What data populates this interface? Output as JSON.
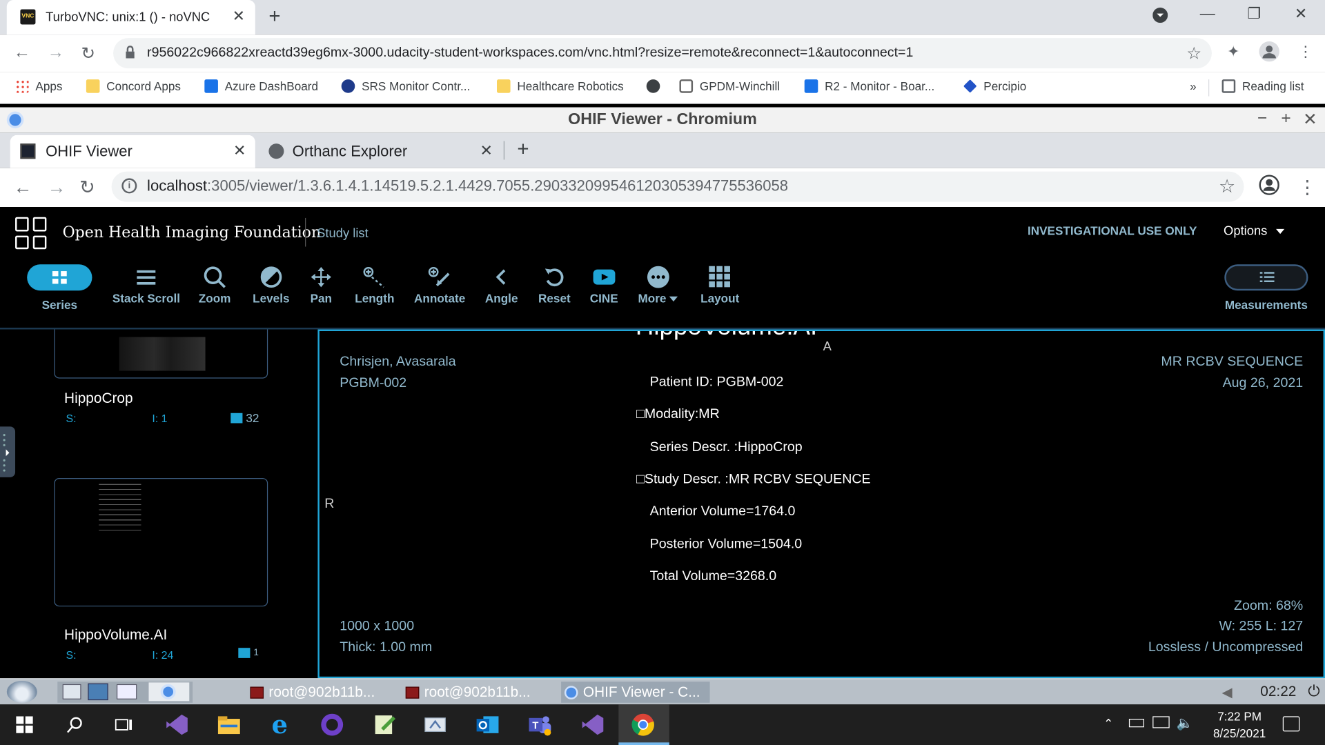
{
  "outer_browser": {
    "tab_title": "TurboVNC: unix:1 () - noVNC",
    "url": "r956022c966822xreactd39eg6mx-3000.udacity-student-workspaces.com/vnc.html?resize=remote&reconnect=1&autoconnect=1",
    "bookmarks": [
      "Apps",
      "Concord Apps",
      "Azure DashBoard",
      "SRS Monitor Contr...",
      "Healthcare Robotics",
      "GPDM-Winchill",
      "R2 - Monitor - Boar...",
      "Percipio"
    ],
    "overflow": "»",
    "reading_list": "Reading list"
  },
  "inner_window": {
    "title": "OHIF Viewer - Chromium",
    "tabs": [
      "OHIF Viewer",
      "Orthanc Explorer"
    ],
    "url_host": "localhost",
    "url_path": ":3005/viewer/1.3.6.1.4.1.14519.5.2.1.4429.7055.290332099546120305394775536058"
  },
  "ohif": {
    "brand": "Open Health Imaging Foundation",
    "study_list": "Study list",
    "notice": "INVESTIGATIONAL USE ONLY",
    "options": "Options",
    "tools": {
      "series": "Series",
      "stack_scroll": "Stack Scroll",
      "zoom": "Zoom",
      "levels": "Levels",
      "pan": "Pan",
      "length": "Length",
      "annotate": "Annotate",
      "angle": "Angle",
      "reset": "Reset",
      "cine": "CINE",
      "more": "More",
      "layout": "Layout",
      "measurements": "Measurements"
    },
    "series_list": [
      {
        "name": "HippoCrop",
        "s": "S:",
        "i": "I: 1",
        "count": "32"
      },
      {
        "name": "HippoVolume.AI",
        "s": "S:",
        "i": "I: 24",
        "count": "1"
      }
    ],
    "viewport": {
      "header_cut": "HippoVolume.AI",
      "orient_top": "A",
      "orient_left": "R",
      "patient_name": "Chrisjen, Avasarala",
      "patient_id": "PGBM-002",
      "study_desc": "MR RCBV SEQUENCE",
      "study_date": "Aug 26, 2021",
      "dims": "1000 x 1000",
      "thick": "Thick: 1.00 mm",
      "zoom": "Zoom: 68%",
      "wl": "W: 255 L: 127",
      "compression": "Lossless / Uncompressed",
      "image_lines": [
        "Patient ID: PGBM-002",
        "□Modality:MR",
        "Series Descr. :HippoCrop",
        "□Study Descr. :MR RCBV SEQUENCE",
        "Anterior Volume=1764.0",
        "Posterior Volume=1504.0",
        "Total Volume=3268.0"
      ]
    }
  },
  "vnc_taskbar": {
    "items": [
      "root@902b11b...",
      "root@902b11b...",
      "OHIF Viewer - C..."
    ],
    "time": "02:22"
  },
  "windows_taskbar": {
    "time": "7:22 PM",
    "date": "8/25/2021"
  }
}
